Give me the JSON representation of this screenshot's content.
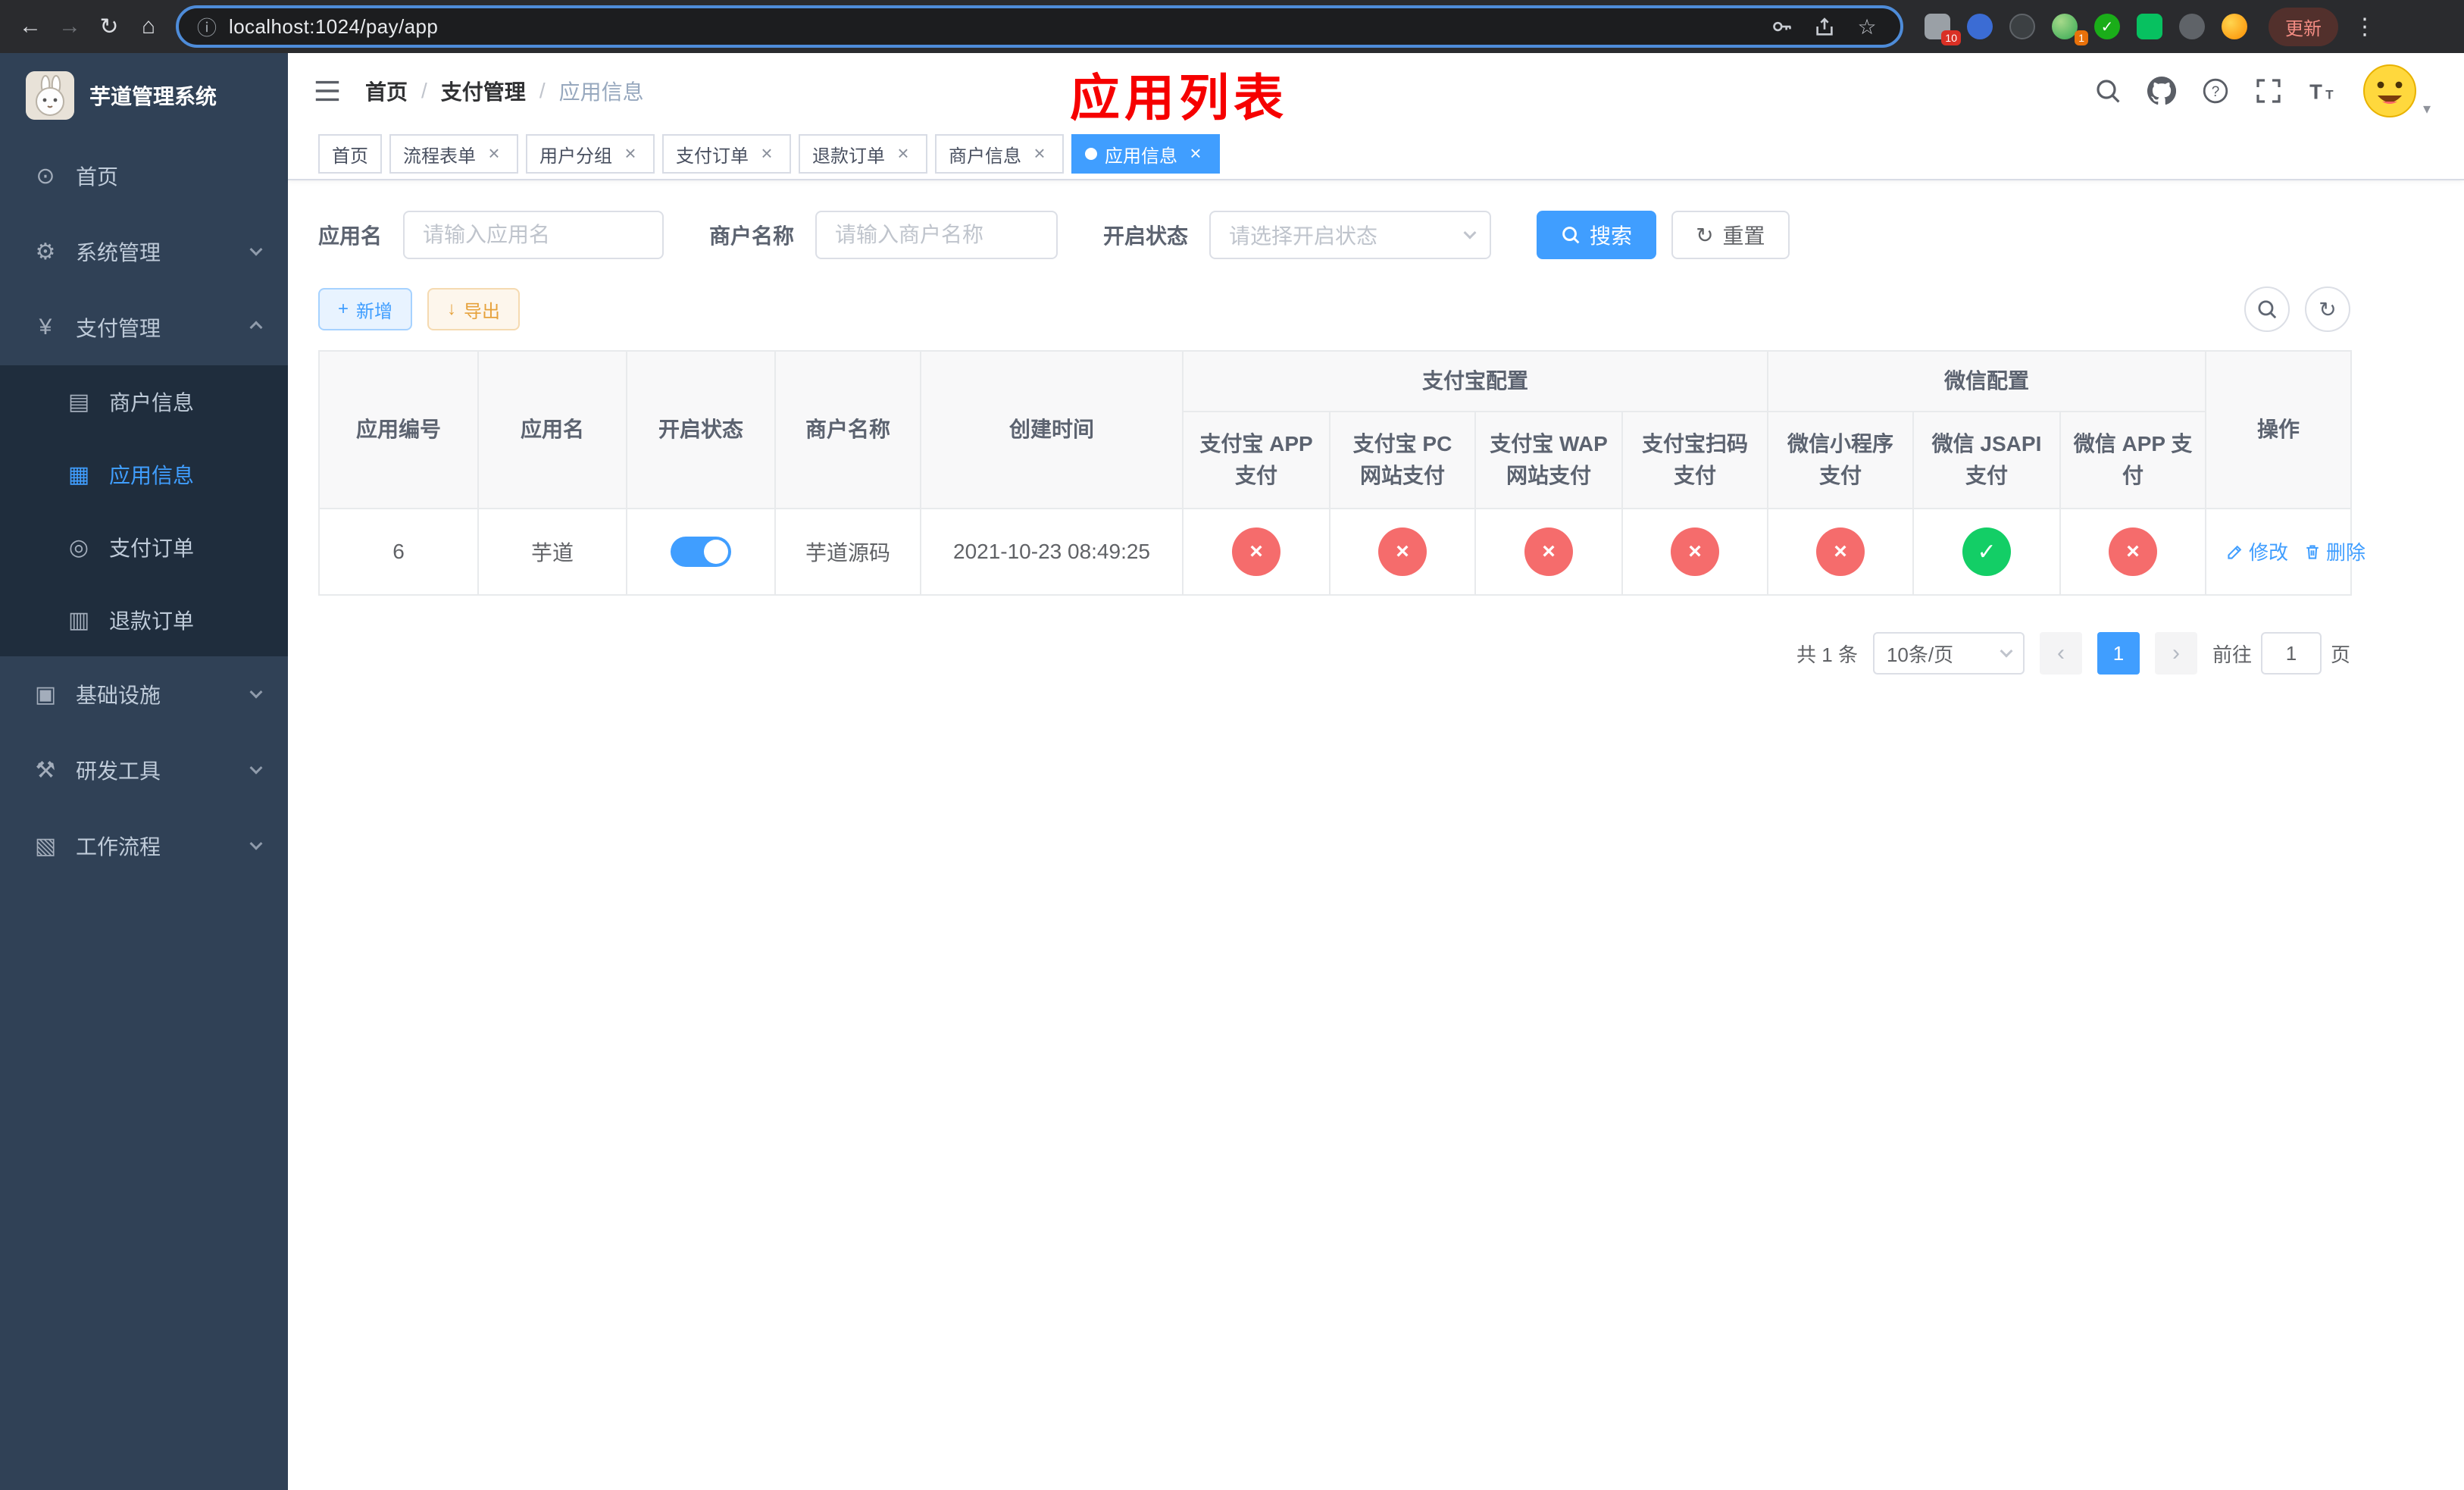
{
  "browser": {
    "url": "localhost:1024/pay/app",
    "update_label": "更新",
    "ext_badge_1": "10",
    "ext_badge_2": "1"
  },
  "sidebar": {
    "title": "芋道管理系统",
    "items": [
      {
        "label": "首页"
      },
      {
        "label": "系统管理"
      },
      {
        "label": "支付管理"
      },
      {
        "label": "基础设施"
      },
      {
        "label": "研发工具"
      },
      {
        "label": "工作流程"
      }
    ],
    "submenu": [
      {
        "label": "商户信息"
      },
      {
        "label": "应用信息"
      },
      {
        "label": "支付订单"
      },
      {
        "label": "退款订单"
      }
    ]
  },
  "header": {
    "breadcrumb": [
      "首页",
      "支付管理",
      "应用信息"
    ],
    "separator": "/",
    "annotation": "应用列表"
  },
  "tabs": [
    {
      "label": "首页"
    },
    {
      "label": "流程表单"
    },
    {
      "label": "用户分组"
    },
    {
      "label": "支付订单"
    },
    {
      "label": "退款订单"
    },
    {
      "label": "商户信息"
    },
    {
      "label": "应用信息"
    }
  ],
  "filters": {
    "app_name_label": "应用名",
    "app_name_placeholder": "请输入应用名",
    "merchant_label": "商户名称",
    "merchant_placeholder": "请输入商户名称",
    "status_label": "开启状态",
    "status_placeholder": "请选择开启状态",
    "search_label": "搜索",
    "reset_label": "重置"
  },
  "toolbar": {
    "add_label": "新增",
    "export_label": "导出"
  },
  "table": {
    "headers": {
      "app_id": "应用编号",
      "app_name": "应用名",
      "status": "开启状态",
      "merchant": "商户名称",
      "created": "创建时间",
      "alipay_group": "支付宝配置",
      "wechat_group": "微信配置",
      "actions": "操作",
      "alipay_app": "支付宝 APP 支付",
      "alipay_pc": "支付宝 PC 网站支付",
      "alipay_wap": "支付宝 WAP 网站支付",
      "alipay_scan": "支付宝扫码支付",
      "wx_mini": "微信小程序支付",
      "wx_jsapi": "微信 JSAPI 支付",
      "wx_app": "微信 APP 支付"
    },
    "rows": [
      {
        "app_id": "6",
        "app_name": "芋道",
        "status_on": true,
        "merchant": "芋道源码",
        "created": "2021-10-23 08:49:25",
        "configs": {
          "alipay_app": false,
          "alipay_pc": false,
          "alipay_wap": false,
          "alipay_scan": false,
          "wx_mini": false,
          "wx_jsapi": true,
          "wx_app": false
        },
        "edit_label": "修改",
        "delete_label": "删除"
      }
    ]
  },
  "pagination": {
    "total": "共 1 条",
    "page_size": "10条/页",
    "page": "1",
    "goto_prefix": "前往",
    "goto_value": "1",
    "goto_suffix": "页"
  },
  "colors": {
    "accent": "#409eff",
    "success": "#13ce66",
    "danger": "#f56c6c",
    "annotation": "#f60000"
  }
}
